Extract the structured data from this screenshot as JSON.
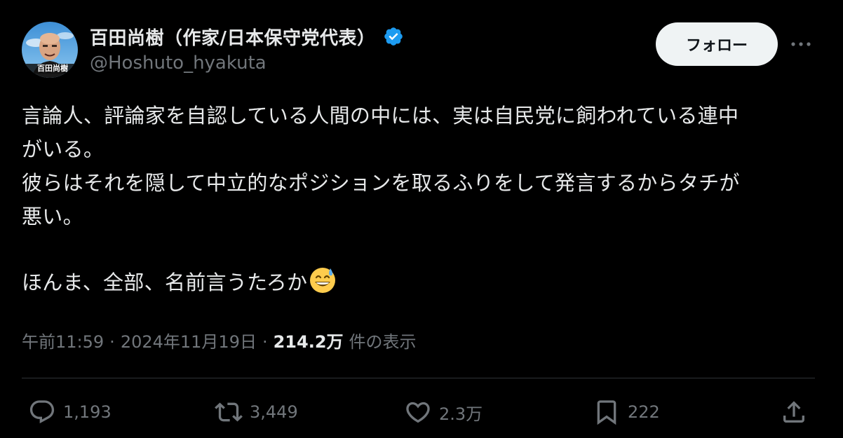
{
  "author": {
    "display_name": "百田尚樹（作家/日本保守党代表）",
    "handle": "@Hoshuto_hyakuta",
    "avatar_caption": "百田尚樹"
  },
  "header": {
    "follow_label": "フォロー",
    "more_icon": "more-horizontal-icon"
  },
  "post": {
    "lines": [
      "言論人、評論家を自認している人間の中には、実は自民党に飼われている連中",
      "がいる。",
      "彼らはそれを隠して中立的なポジションを取るふりをして発言するからタチが",
      "悪い。"
    ],
    "last_line": "ほんま、全部、名前言うたろか",
    "emoji": "grinning-face-with-sweat-icon"
  },
  "meta": {
    "time": "午前11:59",
    "separator1": "·",
    "date": "2024年11月19日",
    "separator2": "·",
    "views_count": "214.2万",
    "views_label": "件の表示"
  },
  "actions": {
    "reply_count": "1,193",
    "repost_count": "3,449",
    "like_count": "2.3万",
    "bookmark_count": "222"
  },
  "colors": {
    "background": "#000000",
    "text_primary": "#e7e9ea",
    "text_secondary": "#71767b",
    "verified": "#1d9bf0",
    "follow_bg": "#eff3f4",
    "divider": "#2f3336"
  }
}
